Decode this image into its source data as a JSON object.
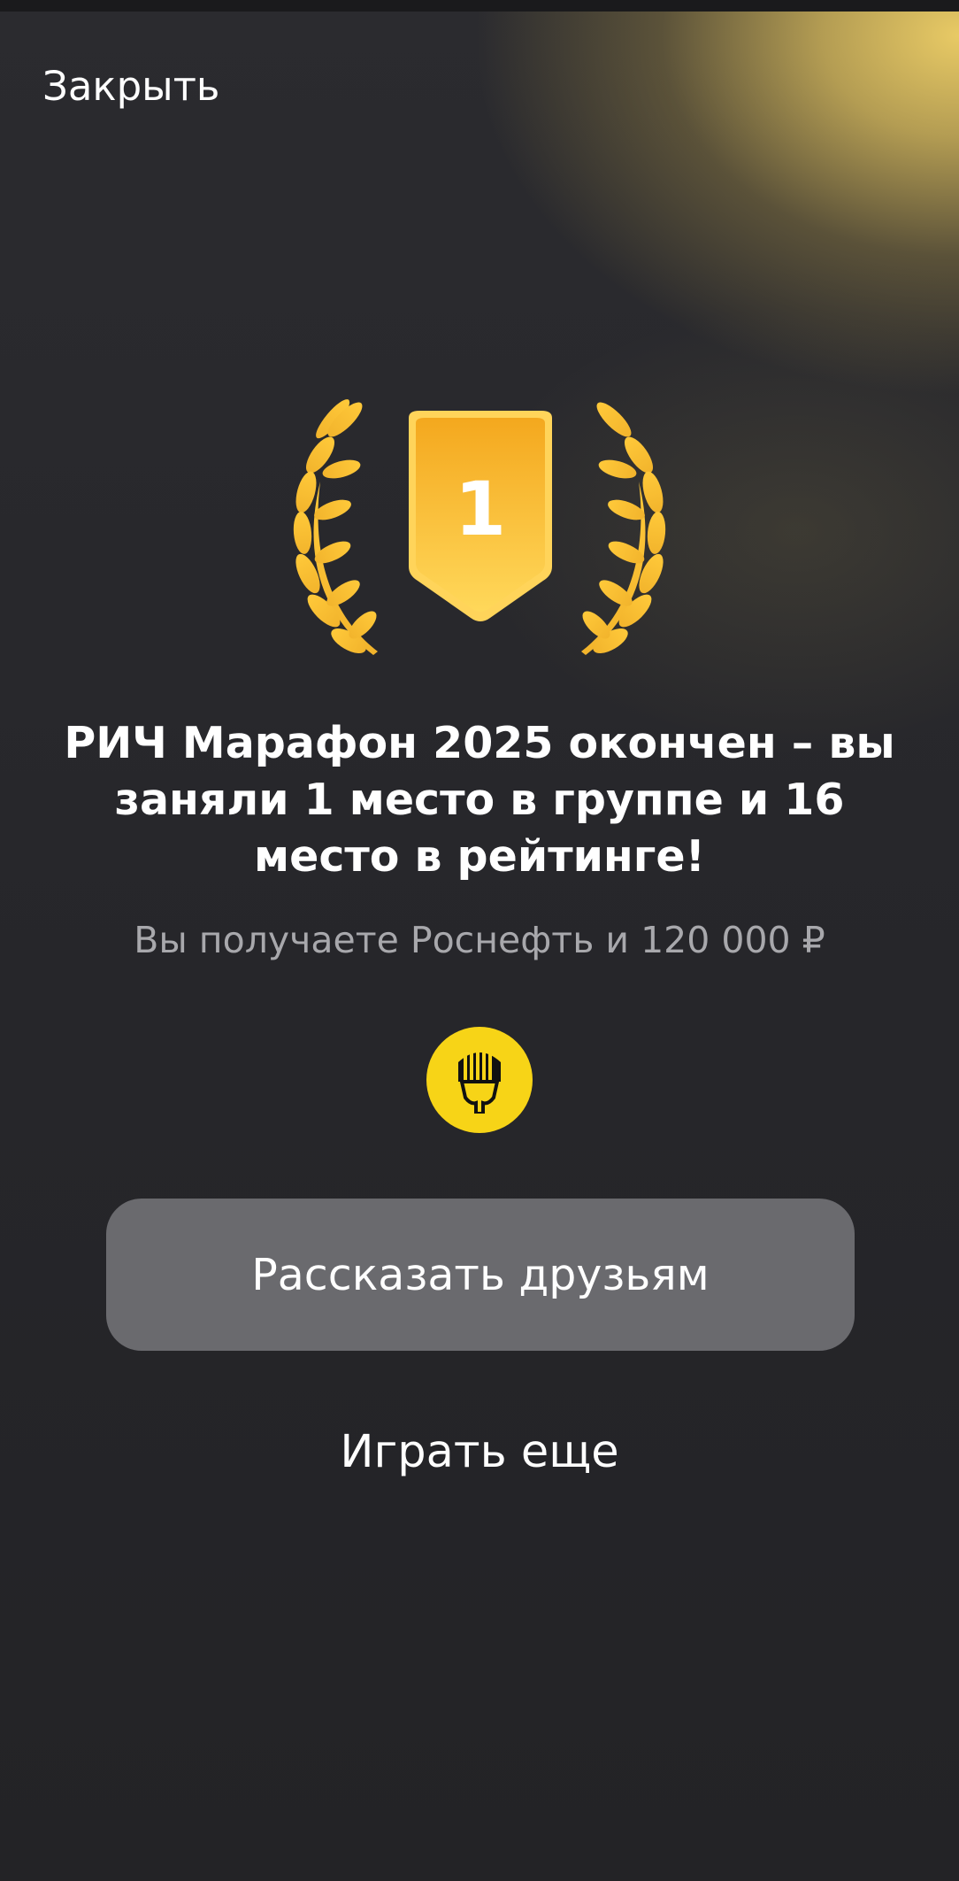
{
  "header": {
    "close_label": "Закрыть"
  },
  "award": {
    "place_number": "1",
    "icon": "laurel-wreath-shield-icon"
  },
  "result": {
    "headline": "РИЧ Марафон 2025 окончен – вы заняли 1 место в группе и 16 место в рейтинге!",
    "reward": "Вы получаете Роснефть и 120 000 ₽"
  },
  "partner": {
    "icon": "rosneft-logo-icon"
  },
  "actions": {
    "share_label": "Рассказать друзьям",
    "play_again_label": "Играть еще"
  },
  "colors": {
    "accent_gold": "#F5B52A",
    "button_bg": "#6A6A6E",
    "logo_yellow": "#F7D417"
  }
}
